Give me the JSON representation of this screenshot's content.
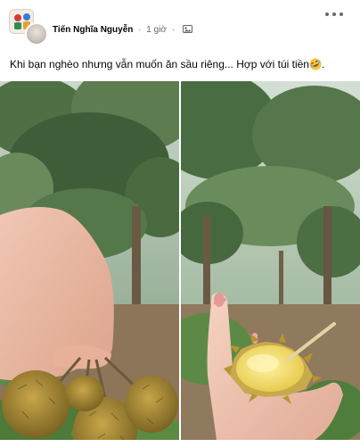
{
  "post": {
    "author": "Tiến Nghĩa Nguyễn",
    "separator": "·",
    "time": "1 giờ",
    "text": "Khi bạn nghèo nhưng vẫn muốn ăn sầu riêng... Hợp với túi tiền",
    "emoji": "rolling-on-the-floor-laughing-emoji"
  },
  "icons": {
    "more": "more-options-icon",
    "privacy": "custom-privacy-icon"
  },
  "photos": [
    {
      "name": "photo-durians-in-hand",
      "subject": "hand holding a bunch of small durians"
    },
    {
      "name": "photo-opened-durian",
      "subject": "hand holding an opened tiny durian with a toothpick"
    }
  ],
  "colors": {
    "name": "#050505",
    "meta": "#65676b",
    "emoji": "#f7c23a"
  }
}
